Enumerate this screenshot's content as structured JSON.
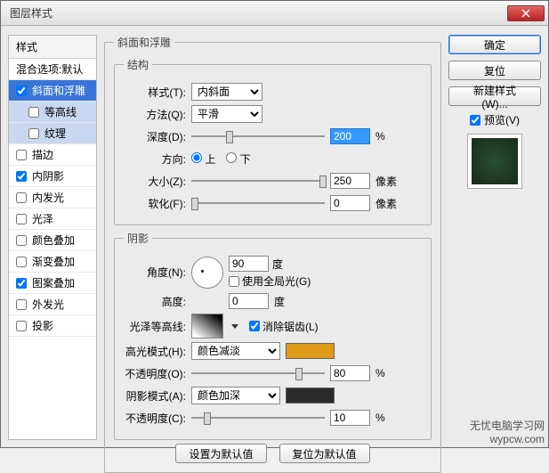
{
  "window": {
    "title": "图层样式"
  },
  "left": {
    "header": "样式",
    "blend": "混合选项:默认",
    "items": [
      {
        "label": "斜面和浮雕",
        "checked": true,
        "selected": true
      },
      {
        "label": "等高线",
        "checked": false,
        "child": true
      },
      {
        "label": "纹理",
        "checked": false,
        "child": true
      },
      {
        "label": "描边",
        "checked": false
      },
      {
        "label": "内阴影",
        "checked": true
      },
      {
        "label": "内发光",
        "checked": false
      },
      {
        "label": "光泽",
        "checked": false
      },
      {
        "label": "颜色叠加",
        "checked": false
      },
      {
        "label": "渐变叠加",
        "checked": false
      },
      {
        "label": "图案叠加",
        "checked": true
      },
      {
        "label": "外发光",
        "checked": false
      },
      {
        "label": "投影",
        "checked": false
      }
    ]
  },
  "panel": {
    "title": "斜面和浮雕",
    "structure": {
      "legend": "结构",
      "style_label": "样式(T):",
      "style_value": "内斜面",
      "tech_label": "方法(Q):",
      "tech_value": "平滑",
      "depth_label": "深度(D):",
      "depth_value": "200",
      "depth_unit": "%",
      "dir_label": "方向:",
      "dir_up": "上",
      "dir_down": "下",
      "size_label": "大小(Z):",
      "size_value": "250",
      "size_unit": "像素",
      "soft_label": "软化(F):",
      "soft_value": "0",
      "soft_unit": "像素"
    },
    "shading": {
      "legend": "阴影",
      "angle_label": "角度(N):",
      "angle_value": "90",
      "angle_unit": "度",
      "global_label": "使用全局光(G)",
      "alt_label": "高度:",
      "alt_value": "0",
      "alt_unit": "度",
      "gloss_label": "光泽等高线:",
      "aa_label": "消除锯齿(L)",
      "hl_label": "高光模式(H):",
      "hl_value": "颜色减淡",
      "hl_color": "#e09a1a",
      "hl_op_label": "不透明度(O):",
      "hl_op_value": "80",
      "hl_op_unit": "%",
      "sh_label": "阴影模式(A):",
      "sh_value": "颜色加深",
      "sh_color": "#2a2a2a",
      "sh_op_label": "不透明度(C):",
      "sh_op_value": "10",
      "sh_op_unit": "%"
    },
    "buttons": {
      "default": "设置为默认值",
      "reset": "复位为默认值"
    }
  },
  "right": {
    "ok": "确定",
    "cancel": "复位",
    "new_style": "新建样式(W)...",
    "preview": "预览(V)"
  },
  "watermark": {
    "line1": "无忧电脑学习网",
    "line2": "wypcw.com"
  }
}
